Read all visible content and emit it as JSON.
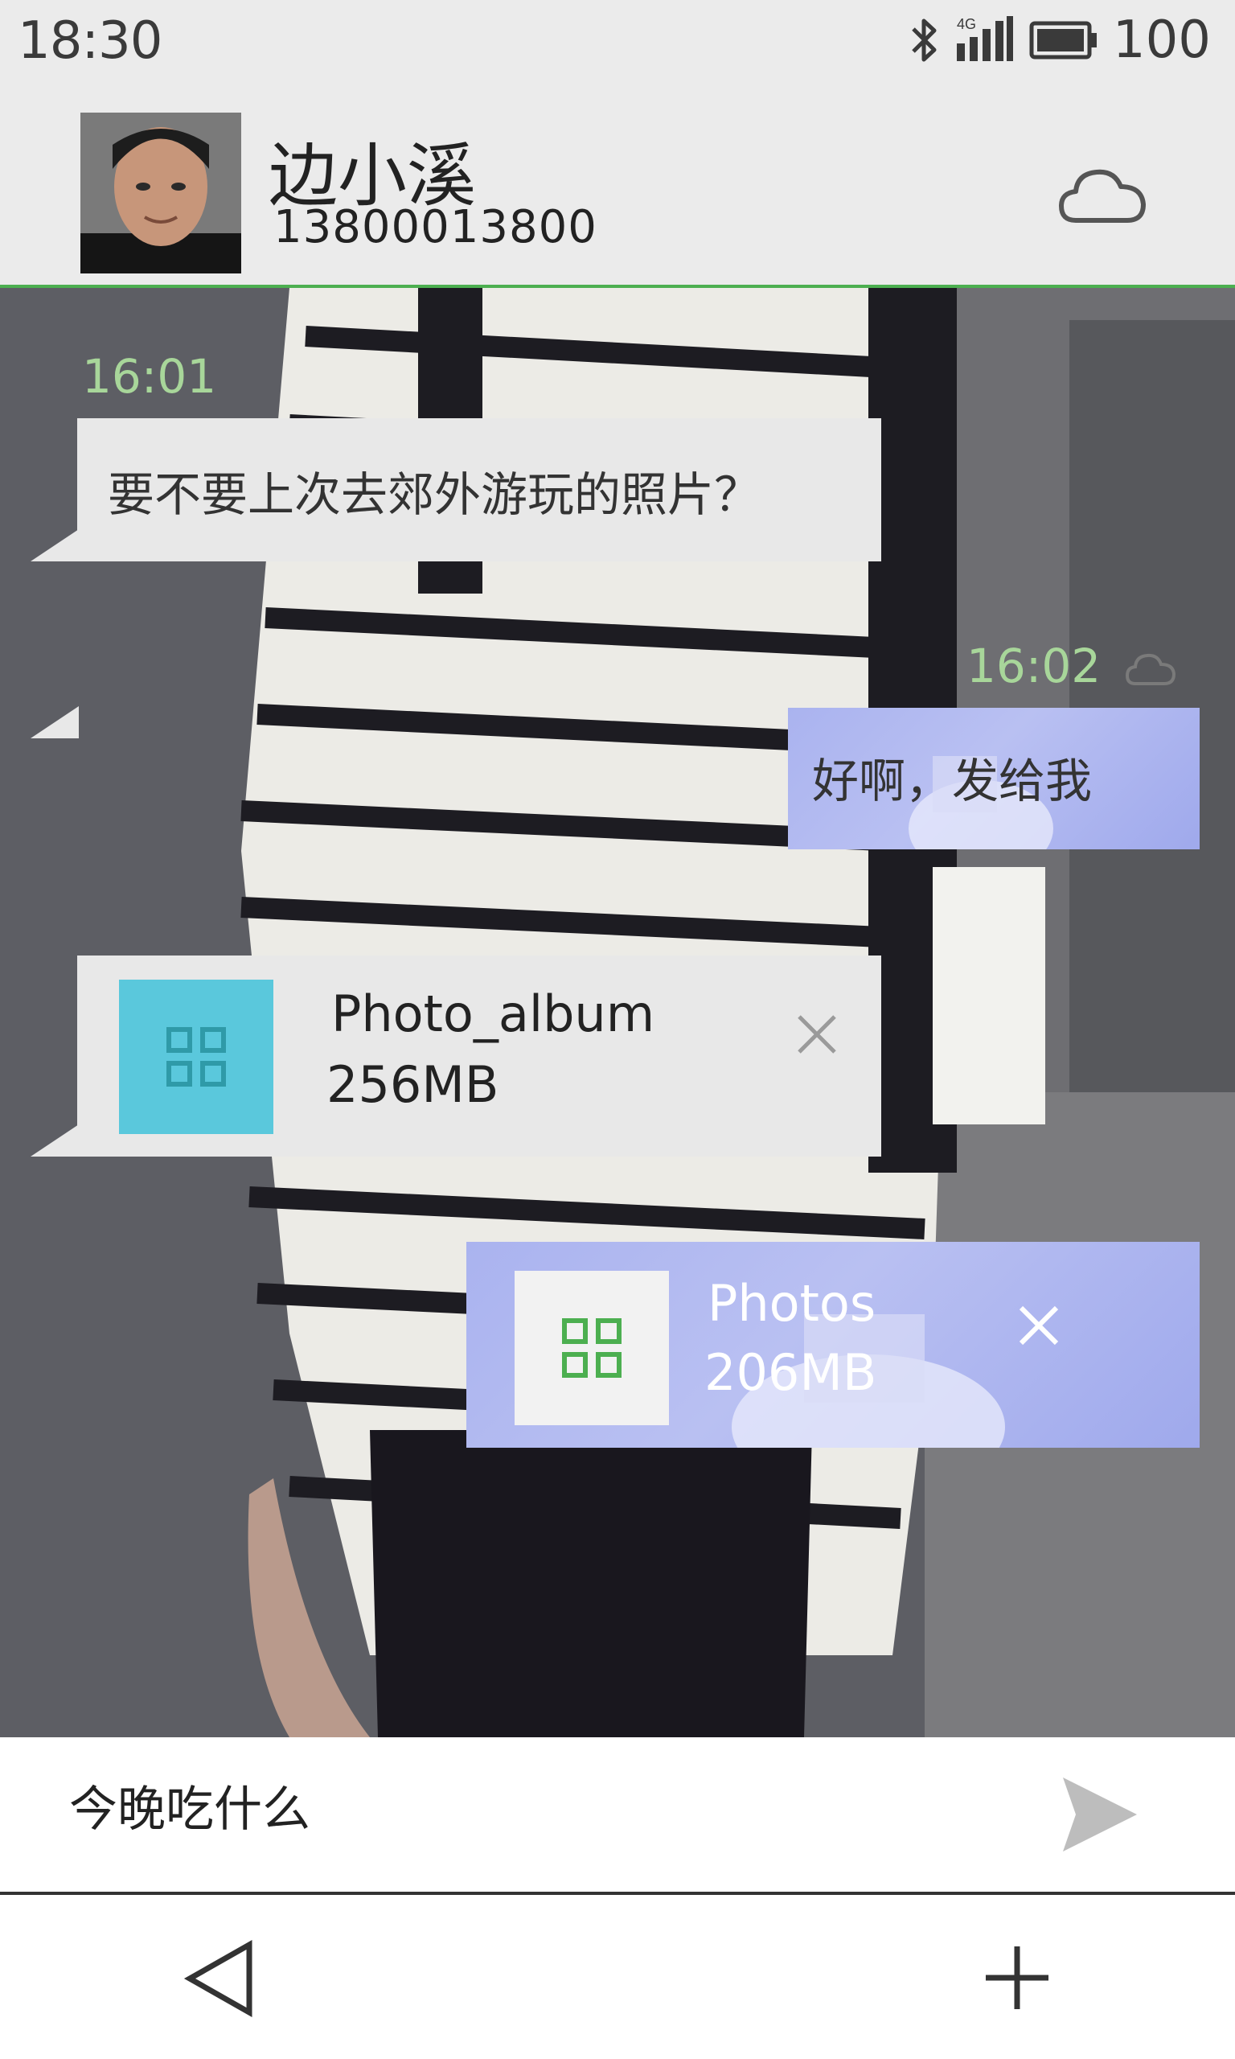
{
  "status_bar": {
    "time": "18:30",
    "network": "4G",
    "battery": "100",
    "icons": [
      "bluetooth-icon",
      "signal-icon",
      "battery-icon"
    ]
  },
  "header": {
    "contact_name": "边小溪",
    "contact_phone": "13800013800",
    "cloud_icon": "cloud-icon"
  },
  "messages": [
    {
      "direction": "incoming",
      "time": "16:01",
      "type": "text",
      "text": "要不要上次去郊外游玩的照片？"
    },
    {
      "direction": "outgoing",
      "time": "16:02",
      "type": "text",
      "text": "好啊，发给我",
      "status_icon": "cloud-icon"
    },
    {
      "direction": "incoming",
      "type": "file",
      "file_name": "Photo_album",
      "file_size": "256MB",
      "icon": "grid-icon",
      "icon_color": "#5ac8dc"
    },
    {
      "direction": "outgoing",
      "type": "file",
      "file_name": "Photos",
      "file_size": "206MB",
      "icon": "grid-icon",
      "icon_color": "#4caf50"
    }
  ],
  "input": {
    "value": "今晚吃什么",
    "send_icon": "send-icon"
  },
  "nav": {
    "back_icon": "back-triangle-icon",
    "add_icon": "plus-icon"
  },
  "colors": {
    "accent": "#4caf50",
    "time_label": "#a8d69a",
    "incoming_bubble": "#e8e8e8",
    "outgoing_bubble": "#aab3ef",
    "header_bg": "#ebebeb"
  }
}
